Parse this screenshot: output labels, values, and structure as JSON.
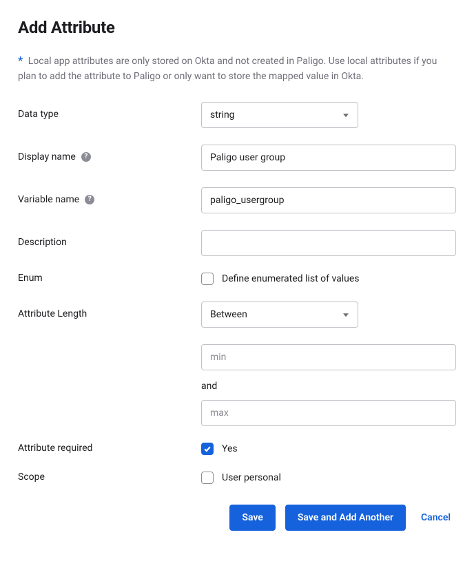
{
  "title": "Add Attribute",
  "info_prefix": "*",
  "info_text": "Local app attributes are only stored on Okta and not created in Paligo. Use local attributes if you plan to add the attribute to Paligo or only want to store the mapped value in Okta.",
  "labels": {
    "data_type": "Data type",
    "display_name": "Display name",
    "variable_name": "Variable name",
    "description": "Description",
    "enum": "Enum",
    "attribute_length": "Attribute Length",
    "attribute_required": "Attribute required",
    "scope": "Scope"
  },
  "fields": {
    "data_type_value": "string",
    "display_name_value": "Paligo user group",
    "variable_name_value": "paligo_usergroup",
    "description_value": "",
    "enum_label": "Define enumerated list of values",
    "attribute_length_value": "Between",
    "min_placeholder": "min",
    "and_word": "and",
    "max_placeholder": "max",
    "required_label": "Yes",
    "scope_label": "User personal"
  },
  "buttons": {
    "save": "Save",
    "save_add_another": "Save and Add Another",
    "cancel": "Cancel"
  }
}
